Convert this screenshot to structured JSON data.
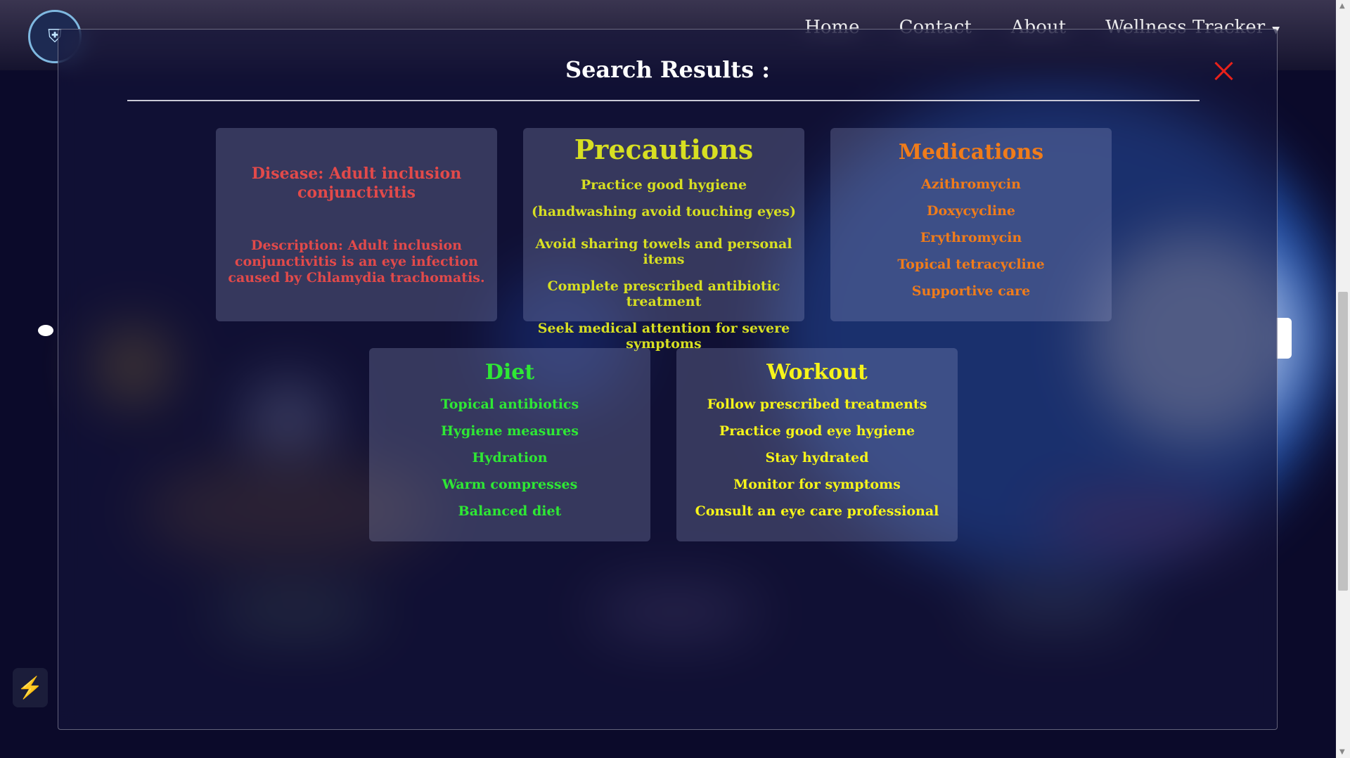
{
  "nav": {
    "logo_icon": "shield-logo",
    "links": [
      "Home",
      "Contact",
      "About",
      "Wellness Tracker"
    ]
  },
  "modal": {
    "title": "Search Results :",
    "close_icon": "close-x-icon",
    "close_color": "#e8211a"
  },
  "disease": {
    "name": "Disease: Adult inclusion conjunctivitis",
    "description": "Description: Adult inclusion conjunctivitis is an eye infection caused by Chlamydia trachomatis.",
    "color": "#e24a4a"
  },
  "precautions": {
    "title": "Precautions",
    "color": "#d7df22",
    "items": [
      "Practice good hygiene (handwashing avoid touching eyes)",
      "Avoid sharing towels and personal items",
      "Complete prescribed antibiotic treatment",
      "Seek medical attention for severe symptoms"
    ]
  },
  "medications": {
    "title": "Medications",
    "color": "#f07c1a",
    "items": [
      "Azithromycin",
      "Doxycycline",
      "Erythromycin",
      "Topical tetracycline",
      "Supportive care"
    ]
  },
  "diet": {
    "title": "Diet",
    "color": "#2ee834",
    "items": [
      "Topical antibiotics",
      "Hygiene measures",
      "Hydration",
      "Warm compresses",
      "Balanced diet"
    ]
  },
  "workout": {
    "title": "Workout",
    "color": "#f6f41a",
    "items": [
      "Follow prescribed treatments",
      "Practice good eye hygiene",
      "Stay hydrated",
      "Monitor for symptoms",
      "Consult an eye care professional"
    ]
  }
}
